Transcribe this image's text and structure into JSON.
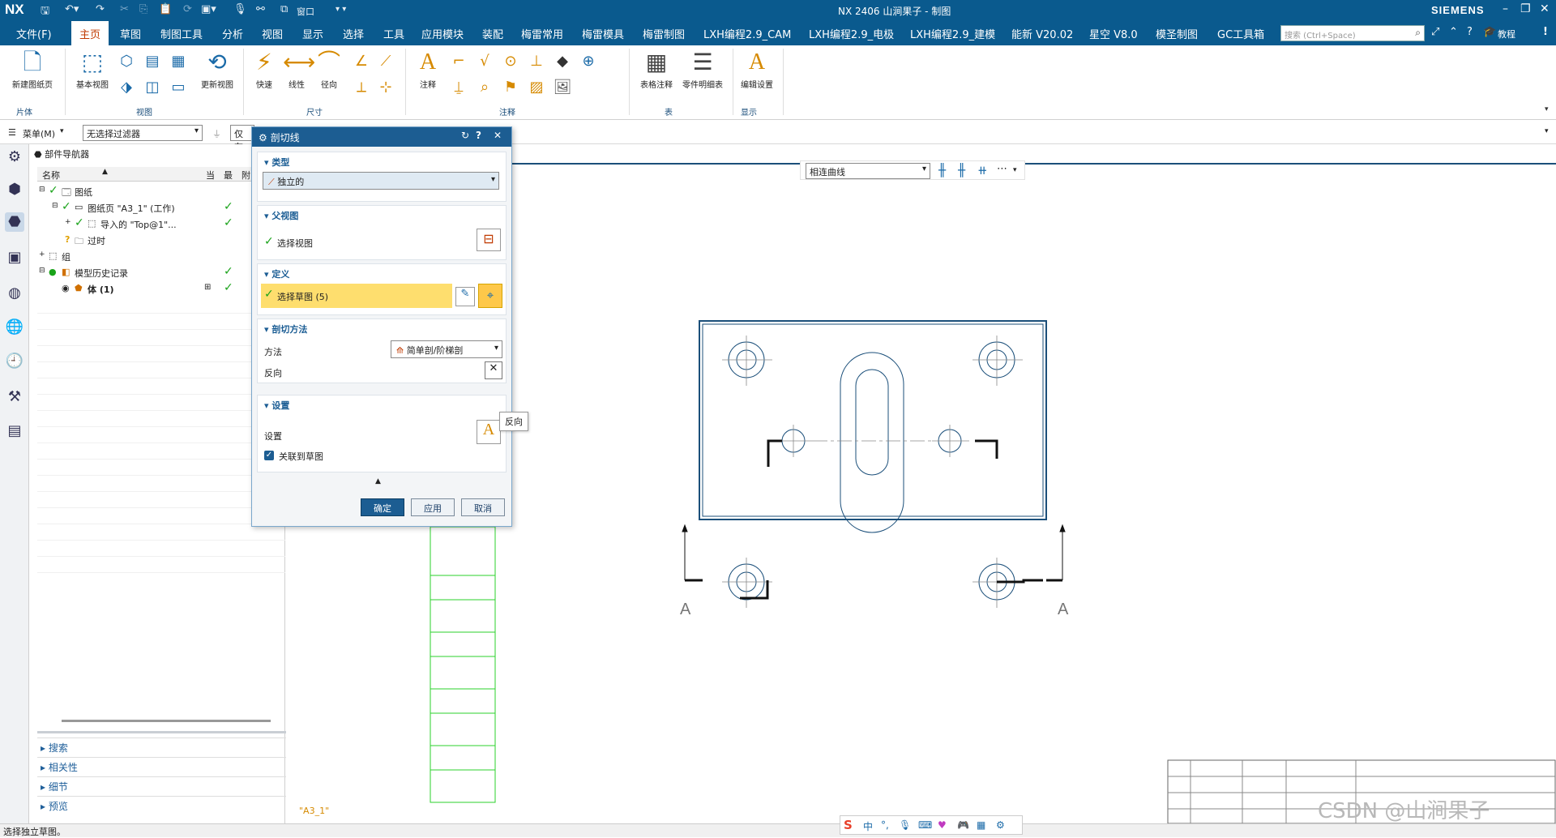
{
  "titlebar": {
    "logo": "NX",
    "window_menu": "窗口",
    "title": "NX 2406 山涧果子 - 制图",
    "brand": "SIEMENS"
  },
  "menubar": {
    "items": [
      "文件(F)",
      "主页",
      "草图",
      "制图工具",
      "分析",
      "视图",
      "显示",
      "选择",
      "工具",
      "应用模块",
      "装配",
      "梅雷常用",
      "梅雷模具",
      "梅雷制图",
      "LXH编程2.9_CAM",
      "LXH编程2.9_电极",
      "LXH编程2.9_建模",
      "能新 V20.02",
      "星空 V8.0",
      "模圣制图",
      "GC工具箱"
    ],
    "active": "主页",
    "search_placeholder": "搜索 (Ctrl+Space)",
    "tutorial": "教程"
  },
  "ribbon": {
    "new_sheet": "新建图纸页",
    "base_view": "基本视图",
    "update_view": "更新视图",
    "quick": "快速",
    "linear": "线性",
    "radial": "径向",
    "note": "注释",
    "table_note": "表格注释",
    "parts_list": "零件明细表",
    "edit_settings": "编辑设置",
    "groups": {
      "sheet": "片体",
      "view": "视图",
      "dimension": "尺寸",
      "annotation": "注释",
      "table": "表",
      "display": "显示"
    }
  },
  "toolbar2": {
    "menu": "菜单(M)",
    "filter": "无选择过滤器",
    "scope": "仅在",
    "curve_rule": "相连曲线"
  },
  "navigator": {
    "title": "部件导航器",
    "col_name": "名称",
    "col_current": "当",
    "col_latest": "最",
    "col_attach": "附",
    "tree": [
      {
        "label": "图纸",
        "checked": true
      },
      {
        "label": "图纸页 \"A3_1\" (工作)",
        "checked": true
      },
      {
        "label": "导入的 \"Top@1\"...",
        "checked": true
      },
      {
        "label": "过时",
        "checked": false
      },
      {
        "label": "组",
        "checked": false
      },
      {
        "label": "模型历史记录",
        "checked": true
      },
      {
        "label": "体 (1)",
        "checked": true
      }
    ],
    "panels": [
      "搜索",
      "相关性",
      "细节",
      "预览"
    ]
  },
  "dialog": {
    "title": "剖切线",
    "section_type": "类型",
    "type_value": "独立的",
    "section_parent": "父视图",
    "select_view": "选择视图",
    "section_define": "定义",
    "select_sketch": "选择草图 (5)",
    "section_method": "剖切方法",
    "method_label": "方法",
    "method_value": "简单剖/阶梯剖",
    "reverse_label": "反向",
    "section_settings": "设置",
    "settings_label": "设置",
    "associate": "关联到草图",
    "associate_checked": true,
    "ok": "确定",
    "apply": "应用",
    "cancel": "取消"
  },
  "tooltip": "反向",
  "drawing": {
    "section_label": "A",
    "sheet_name": "\"A3_1\""
  },
  "status": "选择独立草图。",
  "watermark": "CSDN @山涧果子"
}
